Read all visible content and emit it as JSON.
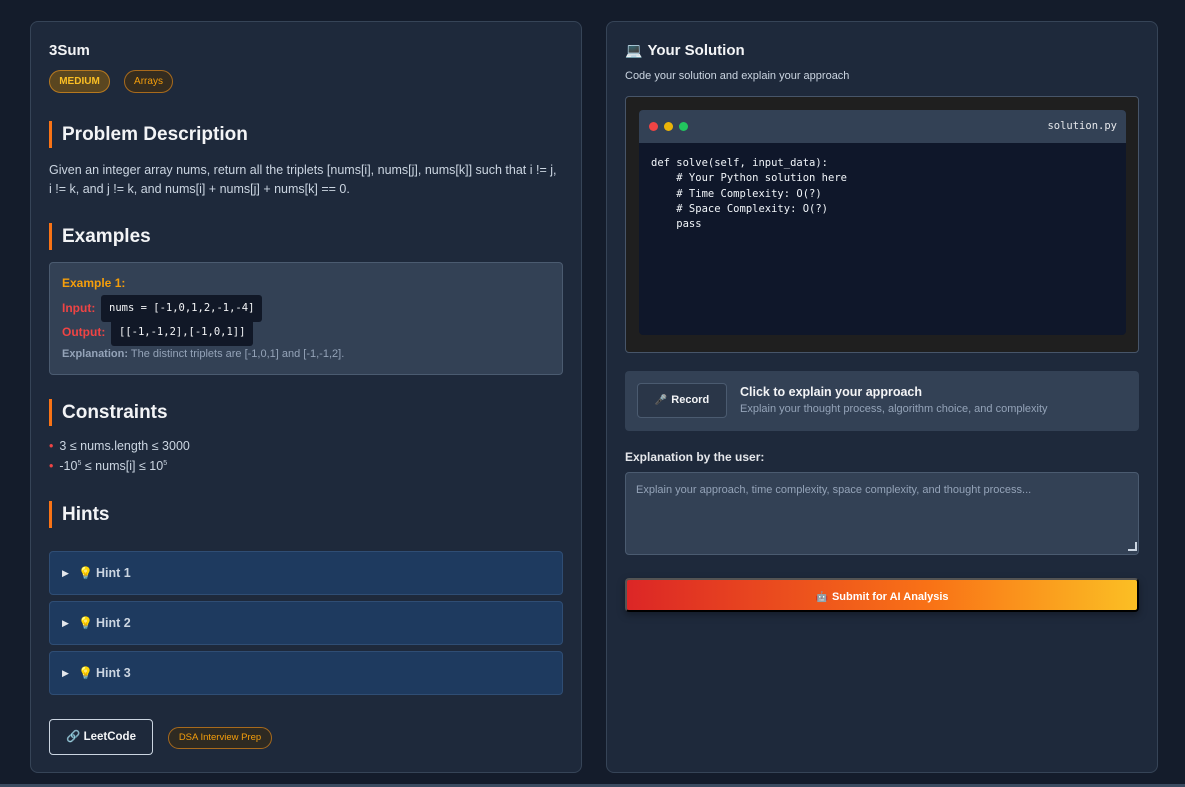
{
  "problem": {
    "title": "3Sum",
    "difficulty": "MEDIUM",
    "topic": "Arrays",
    "description_heading": "Problem Description",
    "description": "Given an integer array nums, return all the triplets [nums[i], nums[j], nums[k]] such that i != j, i != k, and j != k, and nums[i] + nums[j] + nums[k] == 0.",
    "examples_heading": "Examples",
    "examples": [
      {
        "title": "Example 1:",
        "input_label": "Input:",
        "input": "nums = [-1,0,1,2,-1,-4]",
        "output_label": "Output:",
        "output": "[[-1,-1,2],[-1,0,1]]",
        "explanation_label": "Explanation:",
        "explanation": "The distinct triplets are [-1,0,1] and [-1,-1,2]."
      }
    ],
    "constraints_heading": "Constraints",
    "constraints": [
      {
        "text": "3 ≤ nums.length ≤ 3000"
      },
      {
        "pre": "-10",
        "sup1": "5",
        "mid": " ≤ nums[i] ≤ 10",
        "sup2": "5"
      }
    ],
    "hints_heading": "Hints",
    "hints": [
      {
        "label": "Hint 1"
      },
      {
        "label": "Hint 2"
      },
      {
        "label": "Hint 3"
      }
    ],
    "leetcode_label": "LeetCode",
    "tag_label": "DSA Interview Prep"
  },
  "solution": {
    "title": "Your Solution",
    "subtitle": "Code your solution and explain your approach",
    "filename": "solution.py",
    "code": "def solve(self, input_data):\n    # Your Python solution here\n    # Time Complexity: O(?)\n    # Space Complexity: O(?)\n    pass",
    "record_label": "Record",
    "record_title": "Click to explain your approach",
    "record_subtitle": "Explain your thought process, algorithm choice, and complexity",
    "explanation_label": "Explanation by the user:",
    "explanation_placeholder": "Explain your approach, time complexity, space complexity, and thought process...",
    "explanation_value": "",
    "submit_label": "Submit for AI Analysis"
  },
  "icons": {
    "laptop": "laptop-icon",
    "microphone": "microphone-icon",
    "link": "link-icon",
    "lightbulb": "lightbulb-icon",
    "robot": "robot-icon",
    "triangle": "triangle-right-icon"
  },
  "colors": {
    "accent_orange": "#f97316",
    "difficulty_medium": "#fbbf24",
    "output_red": "#ef4444",
    "panel_bg": "#1e293b"
  }
}
